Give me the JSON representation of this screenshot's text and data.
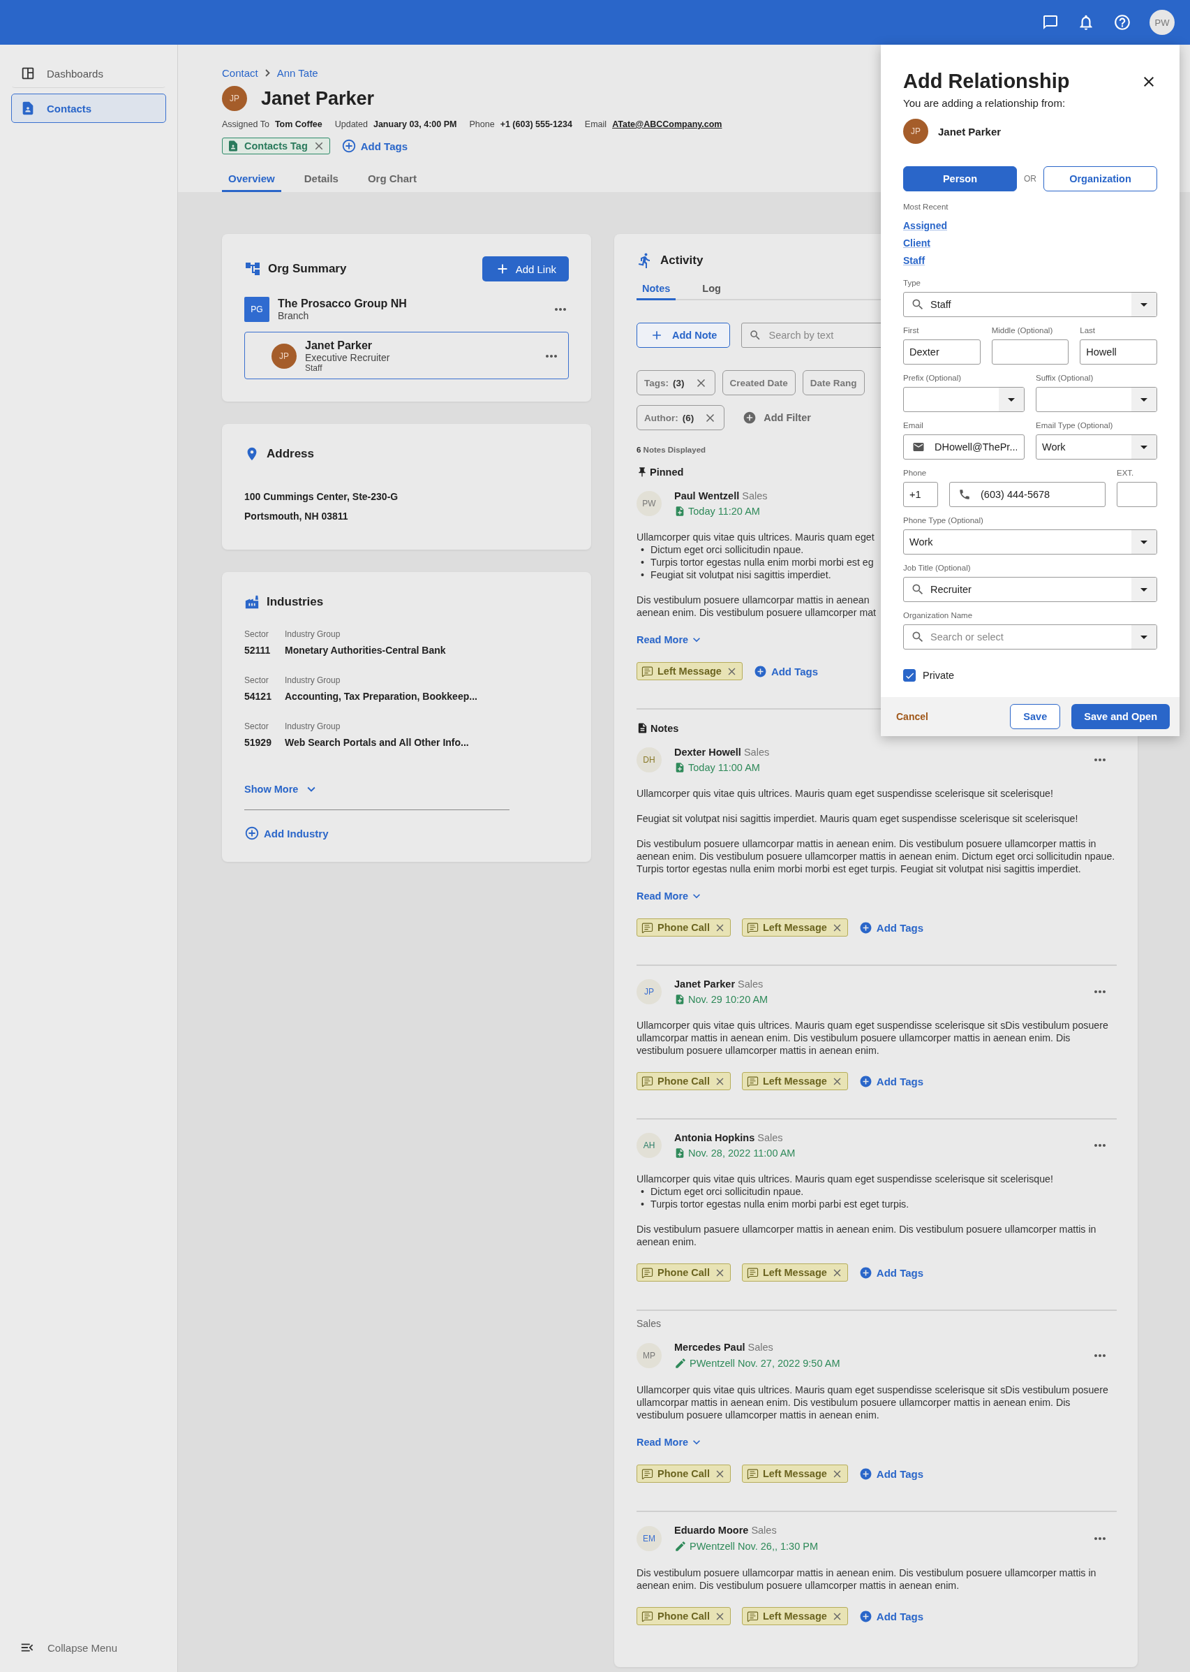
{
  "top_bar": {
    "user_initials": "PW"
  },
  "sidebar": {
    "items": [
      {
        "label": "Dashboards",
        "kind": "dashboard",
        "selected": false
      },
      {
        "label": "Contacts",
        "kind": "contacts",
        "selected": true
      }
    ],
    "collapse": "Collapse Menu"
  },
  "header": {
    "breadcrumb": [
      "Contact",
      "Ann Tate"
    ],
    "initials": "JP",
    "name": "Janet Parker",
    "meta": [
      {
        "label": "Assigned To",
        "value": "Tom Coffee",
        "kind": "plain"
      },
      {
        "label": "Updated",
        "value": "January 03, 4:00 PM",
        "kind": "plain"
      },
      {
        "label": "Phone",
        "value": "+1 (603) 555-1234",
        "kind": "plain"
      },
      {
        "label": "Email",
        "value": "ATate@ABCCompany.com",
        "kind": "link"
      }
    ],
    "tags": [
      "Contacts Tag"
    ],
    "add_tags": "Add Tags",
    "tabs": [
      {
        "label": "Overview",
        "selected": true
      },
      {
        "label": "Details",
        "selected": false
      },
      {
        "label": "Org Chart",
        "selected": false
      }
    ]
  },
  "org_summary": {
    "title": "Org Summary",
    "add_link": "Add Link",
    "org": {
      "initials": "PG",
      "name": "The Prosacco Group NH",
      "type": "Branch"
    },
    "person": {
      "initials": "JP",
      "name": "Janet Parker",
      "title": "Executive Recruiter",
      "role": "Staff"
    }
  },
  "address": {
    "title": "Address",
    "lines": [
      "100 Cummings Center, Ste-230-G",
      "Portsmouth, NH 03811"
    ]
  },
  "industries": {
    "title": "Industries",
    "items": [
      {
        "sector_label": "Sector",
        "group_label": "Industry Group",
        "sector": "52111",
        "group": "Monetary Authorities-Central Bank"
      },
      {
        "sector_label": "Sector",
        "group_label": "Industry Group",
        "sector": "54121",
        "group": "Accounting, Tax Preparation, Bookkeep..."
      },
      {
        "sector_label": "Sector",
        "group_label": "Industry Group",
        "sector": "51929",
        "group": "Web Search Portals and All Other Info..."
      }
    ],
    "show_more": "Show More",
    "add": "Add Industry"
  },
  "activity": {
    "title": "Activity",
    "tabs": [
      {
        "label": "Notes",
        "selected": true
      },
      {
        "label": "Log",
        "selected": false
      }
    ],
    "add_note": "Add Note",
    "search_placeholder": "Search by text",
    "filters": [
      {
        "label": "Tags:",
        "count": "(3)",
        "removable": true
      },
      {
        "label": "Created Date",
        "removable": false
      },
      {
        "label": "Date Rang",
        "removable": false
      },
      {
        "label": "Author:",
        "count": "(6)",
        "removable": true
      }
    ],
    "add_filter": "Add Filter",
    "count": "6",
    "count_label": "Notes Displayed",
    "pinned_label": "Pinned",
    "pinned": [
      {
        "initials": "PW",
        "color": "#777777",
        "author": "Paul Wentzell",
        "dept": "Sales",
        "time": {
          "kind": "created",
          "text": "Today 11:20 AM"
        },
        "menu": false,
        "body": [
          {
            "kind": "cut",
            "lines": [
              "Ullamcorper quis vitae quis ultrices. Mauris quam eget"
            ],
            "bullets": [
              {
                "marker": "•",
                "text": "Dictum eget orci sollicitudin npaue."
              },
              {
                "marker": "•",
                "text": "Turpis tortor egestas nulla enim morbi morbi est eg"
              },
              {
                "marker": "•",
                "text": "Feugiat sit volutpat nisi sagittis imperdiet."
              }
            ]
          },
          {
            "kind": "cut",
            "lines": [
              "Dis vestibulum posuere ullamcorpar mattis in aenean",
              "aenean enim. Dis vestibulum posuere ullamcorper mat"
            ]
          }
        ],
        "read_more": "Read More",
        "tags": [
          "Left Message"
        ],
        "add_tags": "Add Tags"
      }
    ],
    "notes_label": "Notes",
    "notes": [
      {
        "initials": "DH",
        "color": "#8a7a2a",
        "author": "Dexter Howell",
        "dept": "Sales",
        "time": {
          "kind": "created",
          "text": "Today 11:00 AM"
        },
        "menu": true,
        "body": [
          {
            "kind": "text",
            "text": "Ullamcorper quis vitae quis ultrices. Mauris quam eget suspendisse scelerisque sit scelerisque!"
          },
          {
            "kind": "text",
            "text": "Feugiat sit volutpat nisi sagittis imperdiet.  Mauris quam eget suspendisse scelerisque sit scelerisque!"
          },
          {
            "kind": "text",
            "text": "Dis vestibulum posuere ullamcorpar mattis in aenean enim. Dis vestibulum posuere ullamcorper mattis in aenean enim. Dis vestibulum posuere ullamcorper mattis in aenean enim. Dictum eget orci sollicitudin npaue. Turpis tortor egestas nulla enim morbi morbi est eget turpis. Feugiat sit volutpat nisi sagittis imperdiet."
          }
        ],
        "read_more": "Read More",
        "tags": [
          "Phone Call",
          "Left Message"
        ],
        "add_tags": "Add Tags"
      },
      {
        "initials": "JP",
        "color": "#3a6fd0",
        "author": "Janet Parker",
        "dept": "Sales",
        "time": {
          "kind": "created",
          "text": "Nov. 29 10:20 AM"
        },
        "menu": true,
        "body": [
          {
            "kind": "text",
            "text": "Ullamcorper quis vitae quis ultrices. Mauris quam eget suspendisse scelerisque sit sDis vestibulum posuere ullamcorpar mattis in aenean enim. Dis vestibulum posuere ullamcorper mattis in aenean enim. Dis vestibulum posuere ullamcorper mattis in aenean enim."
          }
        ],
        "tags": [
          "Phone Call",
          "Left Message"
        ],
        "add_tags": "Add Tags"
      },
      {
        "initials": "AH",
        "color": "#2f7f6a",
        "author": "Antonia Hopkins",
        "dept": "Sales",
        "time": {
          "kind": "created",
          "text": "Nov. 28, 2022 11:00 AM"
        },
        "menu": true,
        "body": [
          {
            "kind": "text",
            "text": "Ullamcorper quis vitae quis ultrices. Mauris quam eget suspendisse scelerisque sit scelerisque!",
            "bullets": [
              {
                "marker": "•",
                "text": "Dictum eget orci sollicitudin npaue."
              },
              {
                "marker": "•",
                "text": "Turpis tortor egestas nulla enim morbi parbi est eget turpis."
              }
            ]
          },
          {
            "kind": "text",
            "text": "Dis vestibulum pasuere ullamcorper mattis in aenean enim. Dis vestibulum posuere ullamcorper mattis in aenean enim."
          }
        ],
        "tags": [
          "Phone Call",
          "Left Message"
        ],
        "add_tags": "Add Tags"
      },
      {
        "group_label": "Sales",
        "initials": "MP",
        "color": "#777777",
        "author": "Mercedes Paul",
        "dept": "Sales",
        "time": {
          "kind": "edited",
          "text": "PWentzell Nov. 27, 2022 9:50 AM"
        },
        "menu": true,
        "body": [
          {
            "kind": "text",
            "text": "Ullamcorper quis vitae quis ultrices. Mauris quam eget suspendisse scelerisque sit sDis vestibulum posuere ullamcorpar mattis in aenean enim. Dis vestibulum posuere ullamcorper mattis in aenean enim. Dis vestibulum posuere ullamcorper mattis in aenean enim."
          }
        ],
        "read_more": "Read More",
        "tags": [
          "Phone Call",
          "Left Message"
        ],
        "add_tags": "Add Tags"
      },
      {
        "initials": "EM",
        "color": "#3a6fd0",
        "author": "Eduardo Moore",
        "dept": "Sales",
        "time": {
          "kind": "edited",
          "text": "PWentzell Nov. 26,, 1:30 PM"
        },
        "menu": true,
        "body": [
          {
            "kind": "text",
            "text": "Dis vestibulum posuere ullamcorpar mattis in aenean enim. Dis vestibulum posuere ullamcorper mattis in aenean enim. Dis vestibulum posuere ullamcorper mattis in aenean enim."
          }
        ],
        "tags": [
          "Phone Call",
          "Left Message"
        ],
        "add_tags": "Add Tags"
      }
    ]
  },
  "panel": {
    "title": "Add Relationship",
    "subtitle": "You are adding a relationship from:",
    "from": {
      "initials": "JP",
      "name": "Janet Parker"
    },
    "types": [
      {
        "label": "Person",
        "selected": true
      },
      {
        "label": "Organization",
        "selected": false
      }
    ],
    "or": "OR",
    "recent_label": "Most Recent",
    "recent": [
      "Assigned",
      "Client",
      "Staff"
    ],
    "rows": [
      [
        {
          "label": "Type",
          "kind": "search-select",
          "value": "Staff"
        }
      ],
      [
        {
          "label": "First",
          "kind": "text",
          "value": "Dexter"
        },
        {
          "label": "Middle (Optional)",
          "kind": "text"
        },
        {
          "label": "Last",
          "kind": "text",
          "value": "Howell"
        }
      ],
      [
        {
          "label": "Prefix (Optional)",
          "kind": "select"
        },
        {
          "label": "Suffix (Optional)",
          "kind": "select"
        }
      ],
      [
        {
          "label": "Email",
          "kind": "email",
          "value": "DHowell@ThePr..."
        },
        {
          "label": "Email Type (Optional)",
          "kind": "select",
          "value": "Work"
        }
      ],
      [
        {
          "label": "Phone",
          "kind": "code",
          "value": "+1"
        },
        {
          "kind": "phone",
          "value": "(603) 444-5678"
        },
        {
          "label": "EXT.",
          "kind": "ext"
        }
      ],
      [
        {
          "label": "Phone Type (Optional)",
          "kind": "select",
          "value": "Work"
        }
      ],
      [
        {
          "label": "Job Title (Optional)",
          "kind": "search-select",
          "value": "Recruiter"
        }
      ],
      [
        {
          "label": "Organization Name",
          "kind": "search-select",
          "placeholder": "Search or select"
        }
      ]
    ],
    "private": {
      "label": "Private",
      "checked": true
    },
    "cancel": "Cancel",
    "save": "Save",
    "save_open": "Save and Open"
  }
}
